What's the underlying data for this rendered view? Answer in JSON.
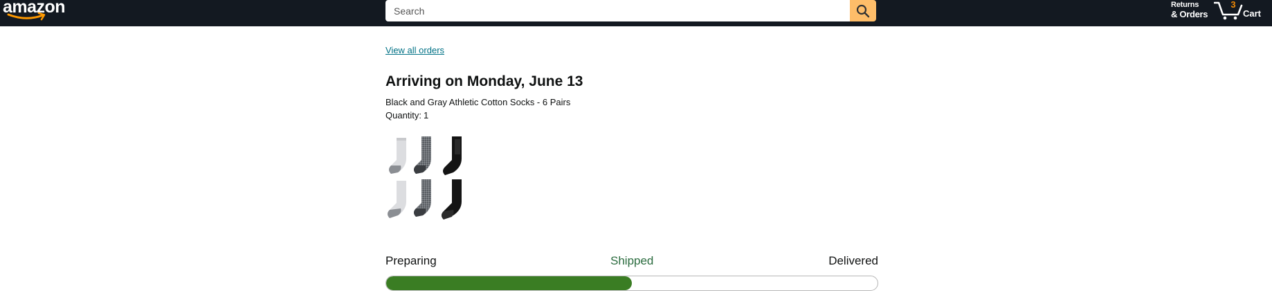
{
  "header": {
    "logo_text": "amazon",
    "search": {
      "placeholder": "Search",
      "value": ""
    },
    "returns": {
      "line1": "Returns",
      "line2": "& Orders"
    },
    "cart": {
      "count": "3",
      "label": "Cart"
    }
  },
  "main": {
    "view_all_orders": "View all orders",
    "arrival_title": "Arriving on Monday, June 13",
    "product_name": "Black and Gray Athletic Cotton Socks - 6 Pairs",
    "quantity_label": "Quantity:",
    "quantity_value": "1",
    "product_image_icon": "socks-image",
    "progress": {
      "stages": [
        "Preparing",
        "Shipped",
        "Delivered"
      ],
      "current_stage": "Shipped",
      "fill_fraction": 0.5
    }
  },
  "colors": {
    "header_bg": "#131921",
    "search_button": "#febd69",
    "link": "#007185",
    "cart_count": "#f08804",
    "progress_fill": "#3a7d23",
    "active_stage": "#2a6b3e"
  }
}
